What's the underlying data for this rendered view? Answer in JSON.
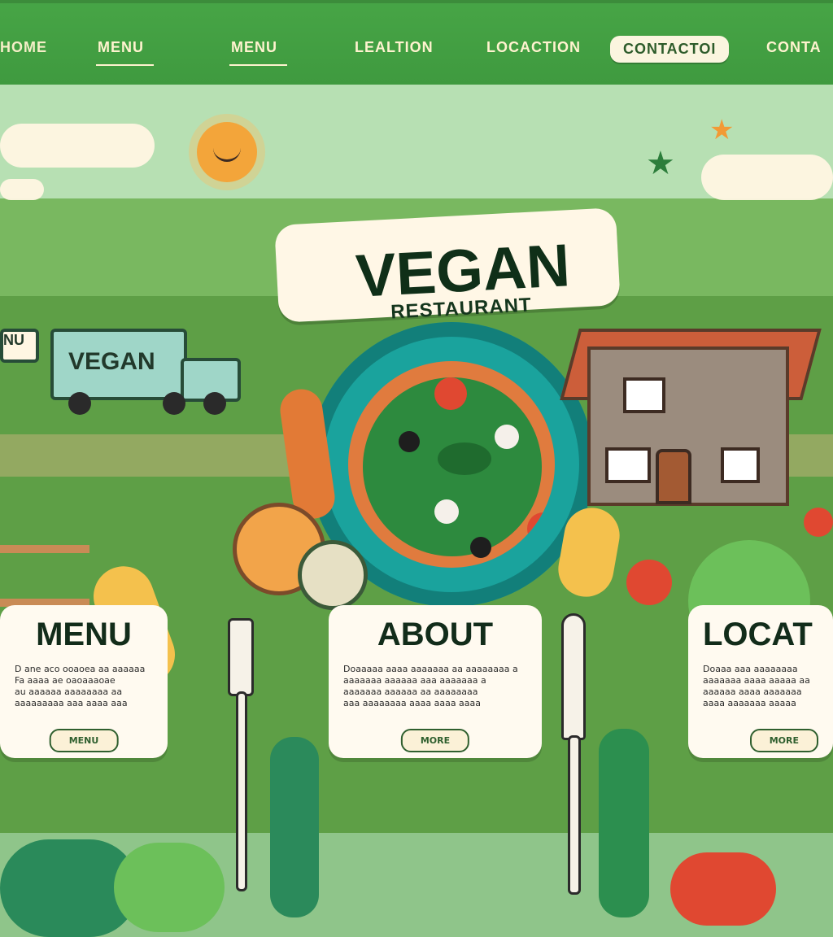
{
  "nav": {
    "items": [
      {
        "label": "HOME",
        "underlined": false
      },
      {
        "label": "MENU",
        "underlined": true
      },
      {
        "label": "MENU",
        "underlined": true
      },
      {
        "label": "LEALTION",
        "underlined": false
      },
      {
        "label": "LOCACTION",
        "underlined": false
      },
      {
        "label": "CONTACTOI",
        "underlined": false,
        "style": "pill"
      },
      {
        "label": "CONTA",
        "underlined": false
      }
    ]
  },
  "hero": {
    "title": "VEGAN",
    "subtitle": "RESTAURANT"
  },
  "truck": {
    "label": "VEGAN",
    "sign": "NU"
  },
  "cards": [
    {
      "title": "MENU",
      "lines": [
        "D ane aco ooaoea aa aaaaaa",
        "Fa aaaa ae oaoaaaoae",
        "au aaaaaa aaaaaaaa aa",
        "aaaaaaaaa aaa aaaa aaa"
      ],
      "button": "MENU"
    },
    {
      "title": "ABOUT",
      "lines": [
        "Doaaaaa aaaa aaaaaaa aa aaaaaaaa a",
        "aaaaaaa aaaaaa aaa aaaaaaa a",
        "aaaaaaa aaaaaa aa aaaaaaaa",
        "aaa aaaaaaaa aaaa aaaa aaaa"
      ],
      "button": "MORE"
    },
    {
      "title": "LOCAT",
      "lines": [
        "Doaaa aaa aaaaaaaa",
        "aaaaaaa aaaa aaaaa aa",
        "aaaaaa aaaa aaaaaaa",
        "aaaa aaaaaaa aaaaa"
      ],
      "button": "MORE"
    }
  ],
  "colors": {
    "nav_bg": "#47a546",
    "nav_text": "#fff3cf",
    "contact_pill": "#fbf5df",
    "bowl": "#1aa39d",
    "title_text": "#0f2f18"
  }
}
